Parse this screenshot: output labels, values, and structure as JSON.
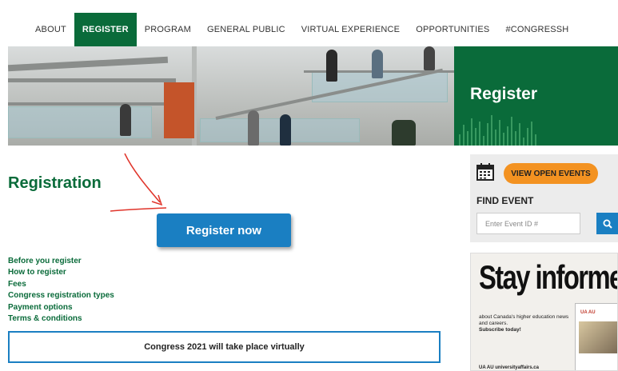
{
  "nav": {
    "items": [
      {
        "label": "ABOUT"
      },
      {
        "label": "REGISTER"
      },
      {
        "label": "PROGRAM"
      },
      {
        "label": "GENERAL PUBLIC"
      },
      {
        "label": "VIRTUAL EXPERIENCE"
      },
      {
        "label": "OPPORTUNITIES"
      },
      {
        "label": "#CONGRESSH"
      }
    ],
    "active": "REGISTER"
  },
  "hero": {
    "title": "Register"
  },
  "main": {
    "heading": "Registration",
    "register_button": "Register now",
    "links": [
      {
        "label": "Before you register"
      },
      {
        "label": "How to register"
      },
      {
        "label": "Fees"
      },
      {
        "label": "Congress registration types"
      },
      {
        "label": "Payment options"
      },
      {
        "label": "Terms & conditions"
      }
    ],
    "notice": "Congress 2021 will take place virtually"
  },
  "events": {
    "open_events_button": "VIEW OPEN EVENTS",
    "find_label": "FIND EVENT",
    "input_placeholder": "Enter Event ID #",
    "icon_calendar": "calendar-icon",
    "icon_search": "search-icon"
  },
  "ad": {
    "title": "Stay informed",
    "text": "about Canada's higher education news and careers.",
    "subscribe": "Subscribe today!",
    "card_logo": "UA AU",
    "footer": "UA AU   universityaffairs.ca"
  },
  "colors": {
    "brand_green": "#0a6b3a",
    "button_blue": "#1a7fc2",
    "orange": "#f39221",
    "annotation_red": "#e0342a"
  }
}
